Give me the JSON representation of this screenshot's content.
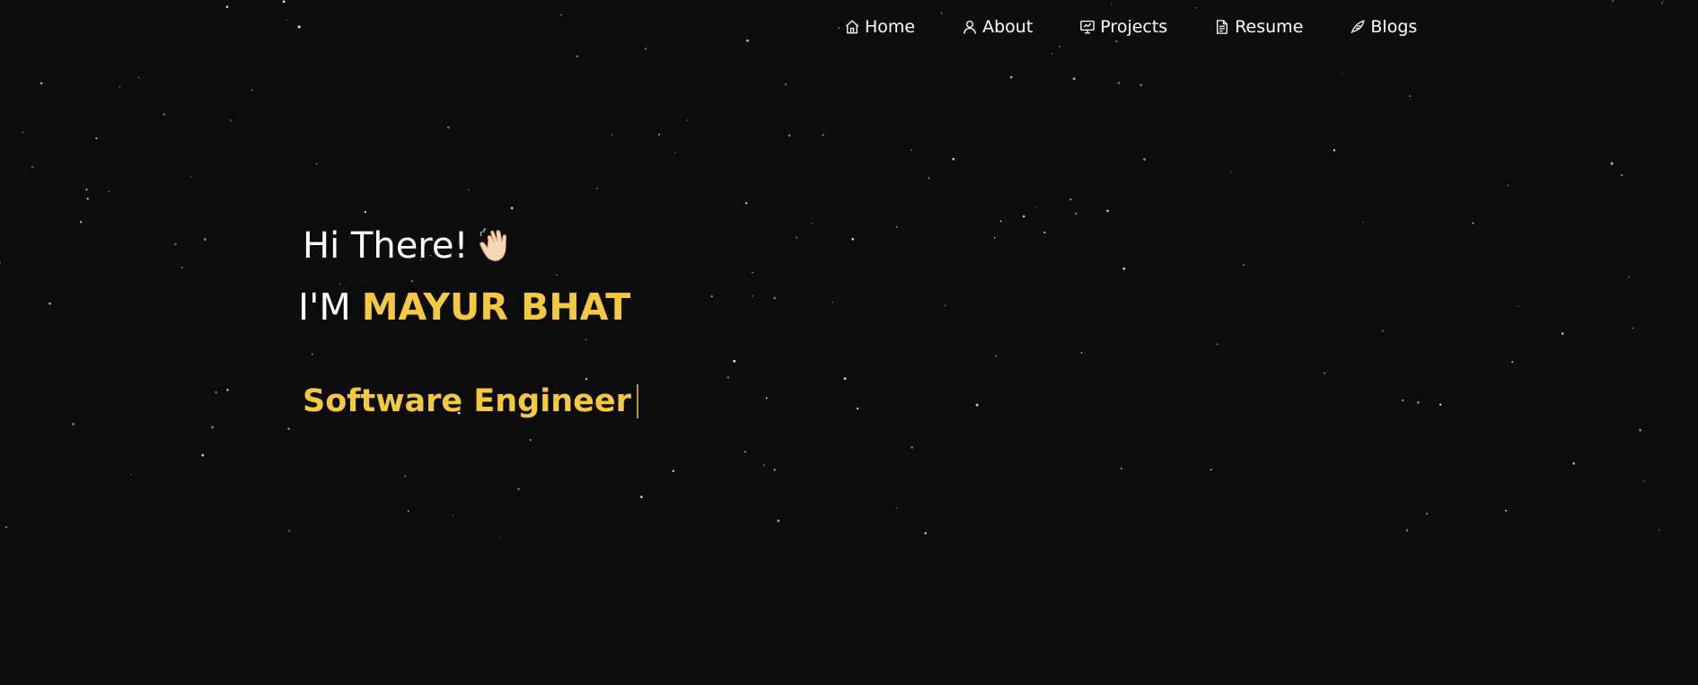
{
  "nav": {
    "items": [
      {
        "label": "Home",
        "icon": "home-icon"
      },
      {
        "label": "About",
        "icon": "user-icon"
      },
      {
        "label": "Projects",
        "icon": "presentation-icon"
      },
      {
        "label": "Resume",
        "icon": "document-icon"
      },
      {
        "label": "Blogs",
        "icon": "quill-icon"
      }
    ]
  },
  "hero": {
    "greeting": "Hi There!",
    "intro_prefix": "I'M",
    "name": "MAYUR BHAT",
    "role": "Software Engineer"
  },
  "colors": {
    "background": "#0c0c0c",
    "accent": "#f5c842",
    "text": "#ffffff"
  }
}
